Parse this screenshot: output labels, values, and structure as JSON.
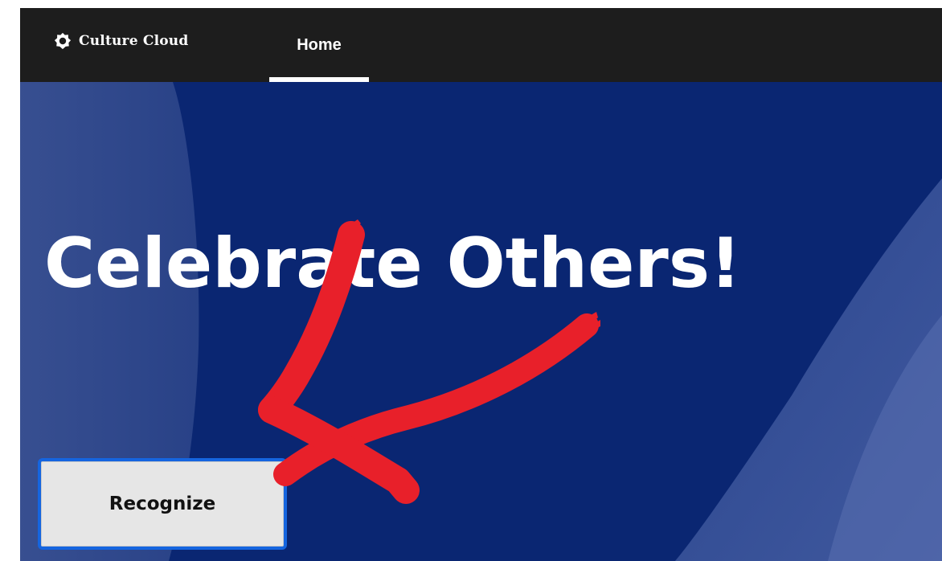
{
  "header": {
    "brand_name": "Culture Cloud",
    "brand_icon": "gear-icon",
    "tabs": [
      {
        "label": "Home",
        "active": true
      }
    ]
  },
  "hero": {
    "headline": "Celebrate Others!",
    "recognize_button": "Recognize",
    "annotation": "red-arrow-pointing-to-recognize-button"
  },
  "colors": {
    "topbar": "#1d1d1d",
    "hero_background": "#0a2672",
    "button_border": "#1565e0",
    "button_fill": "#e6e6e6",
    "arrow": "#e8202a"
  }
}
